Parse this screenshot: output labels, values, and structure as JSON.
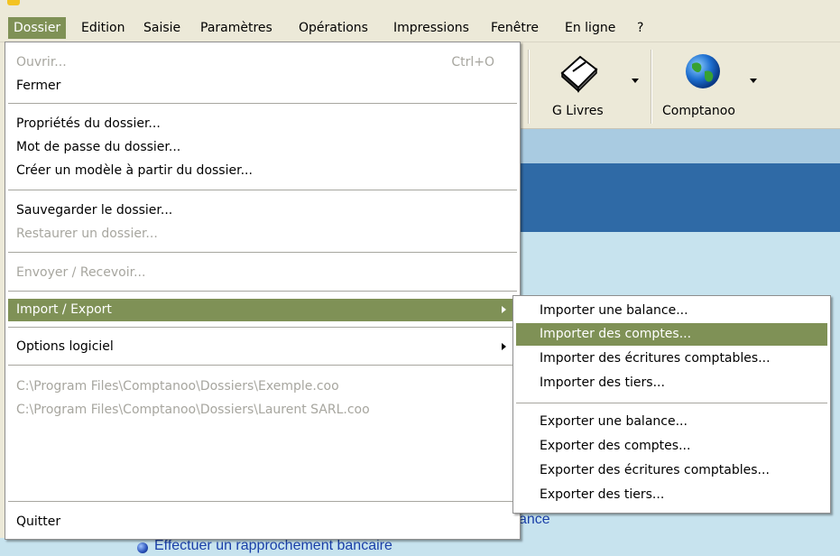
{
  "menubar": {
    "items": [
      "Dossier",
      "Edition",
      "Saisie",
      "Paramètres",
      "Opérations",
      "Impressions",
      "Fenêtre",
      "En ligne",
      "?"
    ]
  },
  "toolbar": {
    "buttons": [
      {
        "label": "G Livres",
        "icon": "book-icon"
      },
      {
        "label": "Comptanoo",
        "icon": "globe-icon"
      }
    ]
  },
  "dossier_menu": {
    "ouvrir": {
      "label": "Ouvrir...",
      "shortcut": "Ctrl+O"
    },
    "fermer": "Fermer",
    "proprietes": "Propriétés du dossier...",
    "mot_de_passe": "Mot de passe du dossier...",
    "creer_modele": "Créer un modèle à partir du dossier...",
    "sauvegarder": "Sauvegarder le dossier...",
    "restaurer": "Restaurer un dossier...",
    "envoyer": "Envoyer / Recevoir...",
    "import_export": "Import / Export",
    "options": "Options logiciel",
    "recent_1": "C:\\Program Files\\Comptanoo\\Dossiers\\Exemple.coo",
    "recent_2": "C:\\Program Files\\Comptanoo\\Dossiers\\Laurent SARL.coo",
    "quitter": "Quitter"
  },
  "import_export_submenu": {
    "importer_balance": "Importer une balance...",
    "importer_comptes": "Importer des comptes...",
    "importer_ecritures": "Importer des écritures comptables...",
    "importer_tiers": "Importer des tiers...",
    "exporter_balance": "Exporter une balance...",
    "exporter_comptes": "Exporter des comptes...",
    "exporter_ecritures": "Exporter des écritures comptables...",
    "exporter_tiers": "Exporter des tiers..."
  },
  "content": {
    "partial_link": "ance",
    "link_rapprochement": "Effectuer un rapprochement bancaire"
  },
  "colors": {
    "highlight": "#7f9156",
    "menu_bg": "#ece9d8",
    "content_bg": "#c7e3ee",
    "band_blue": "#2f6aa6",
    "link": "#1a3fa8"
  }
}
